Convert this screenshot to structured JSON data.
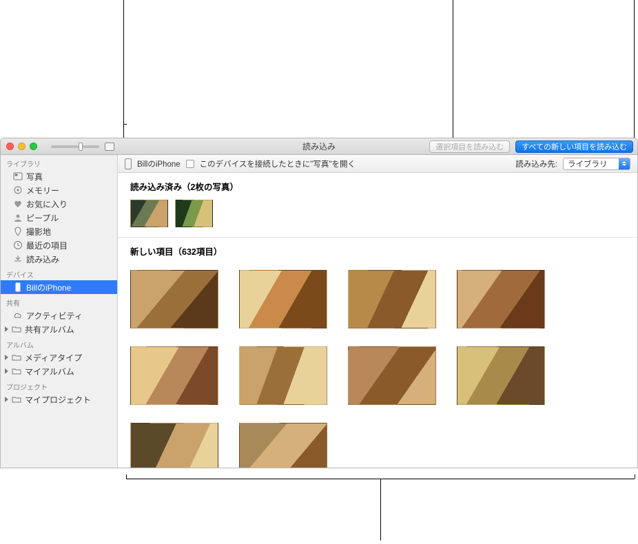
{
  "window": {
    "title": "読み込み",
    "import_selected_btn": "選択項目を読み込む",
    "import_all_btn": "すべての新しい項目を読み込む"
  },
  "controlbar": {
    "device_name": "BillのiPhone",
    "open_on_connect_label": "このデバイスを接続したときに\"写真\"を開く",
    "import_to_label": "読み込み先:",
    "import_to_value": "ライブラリ"
  },
  "sections": {
    "imported_title": "読み込み済み（2枚の写真）",
    "new_title": "新しい項目（632項目）"
  },
  "sidebar": {
    "library_header": "ライブラリ",
    "photos": "写真",
    "memories": "メモリー",
    "favorites": "お気に入り",
    "people": "ピープル",
    "places": "撮影地",
    "recent": "最近の項目",
    "import": "読み込み",
    "devices_header": "デバイス",
    "device_iphone": "BillのiPhone",
    "shared_header": "共有",
    "activity": "アクティビティ",
    "shared_albums": "共有アルバム",
    "albums_header": "アルバム",
    "media_types": "メディアタイプ",
    "my_albums": "マイアルバム",
    "projects_header": "プロジェクト",
    "my_projects": "マイプロジェクト"
  }
}
